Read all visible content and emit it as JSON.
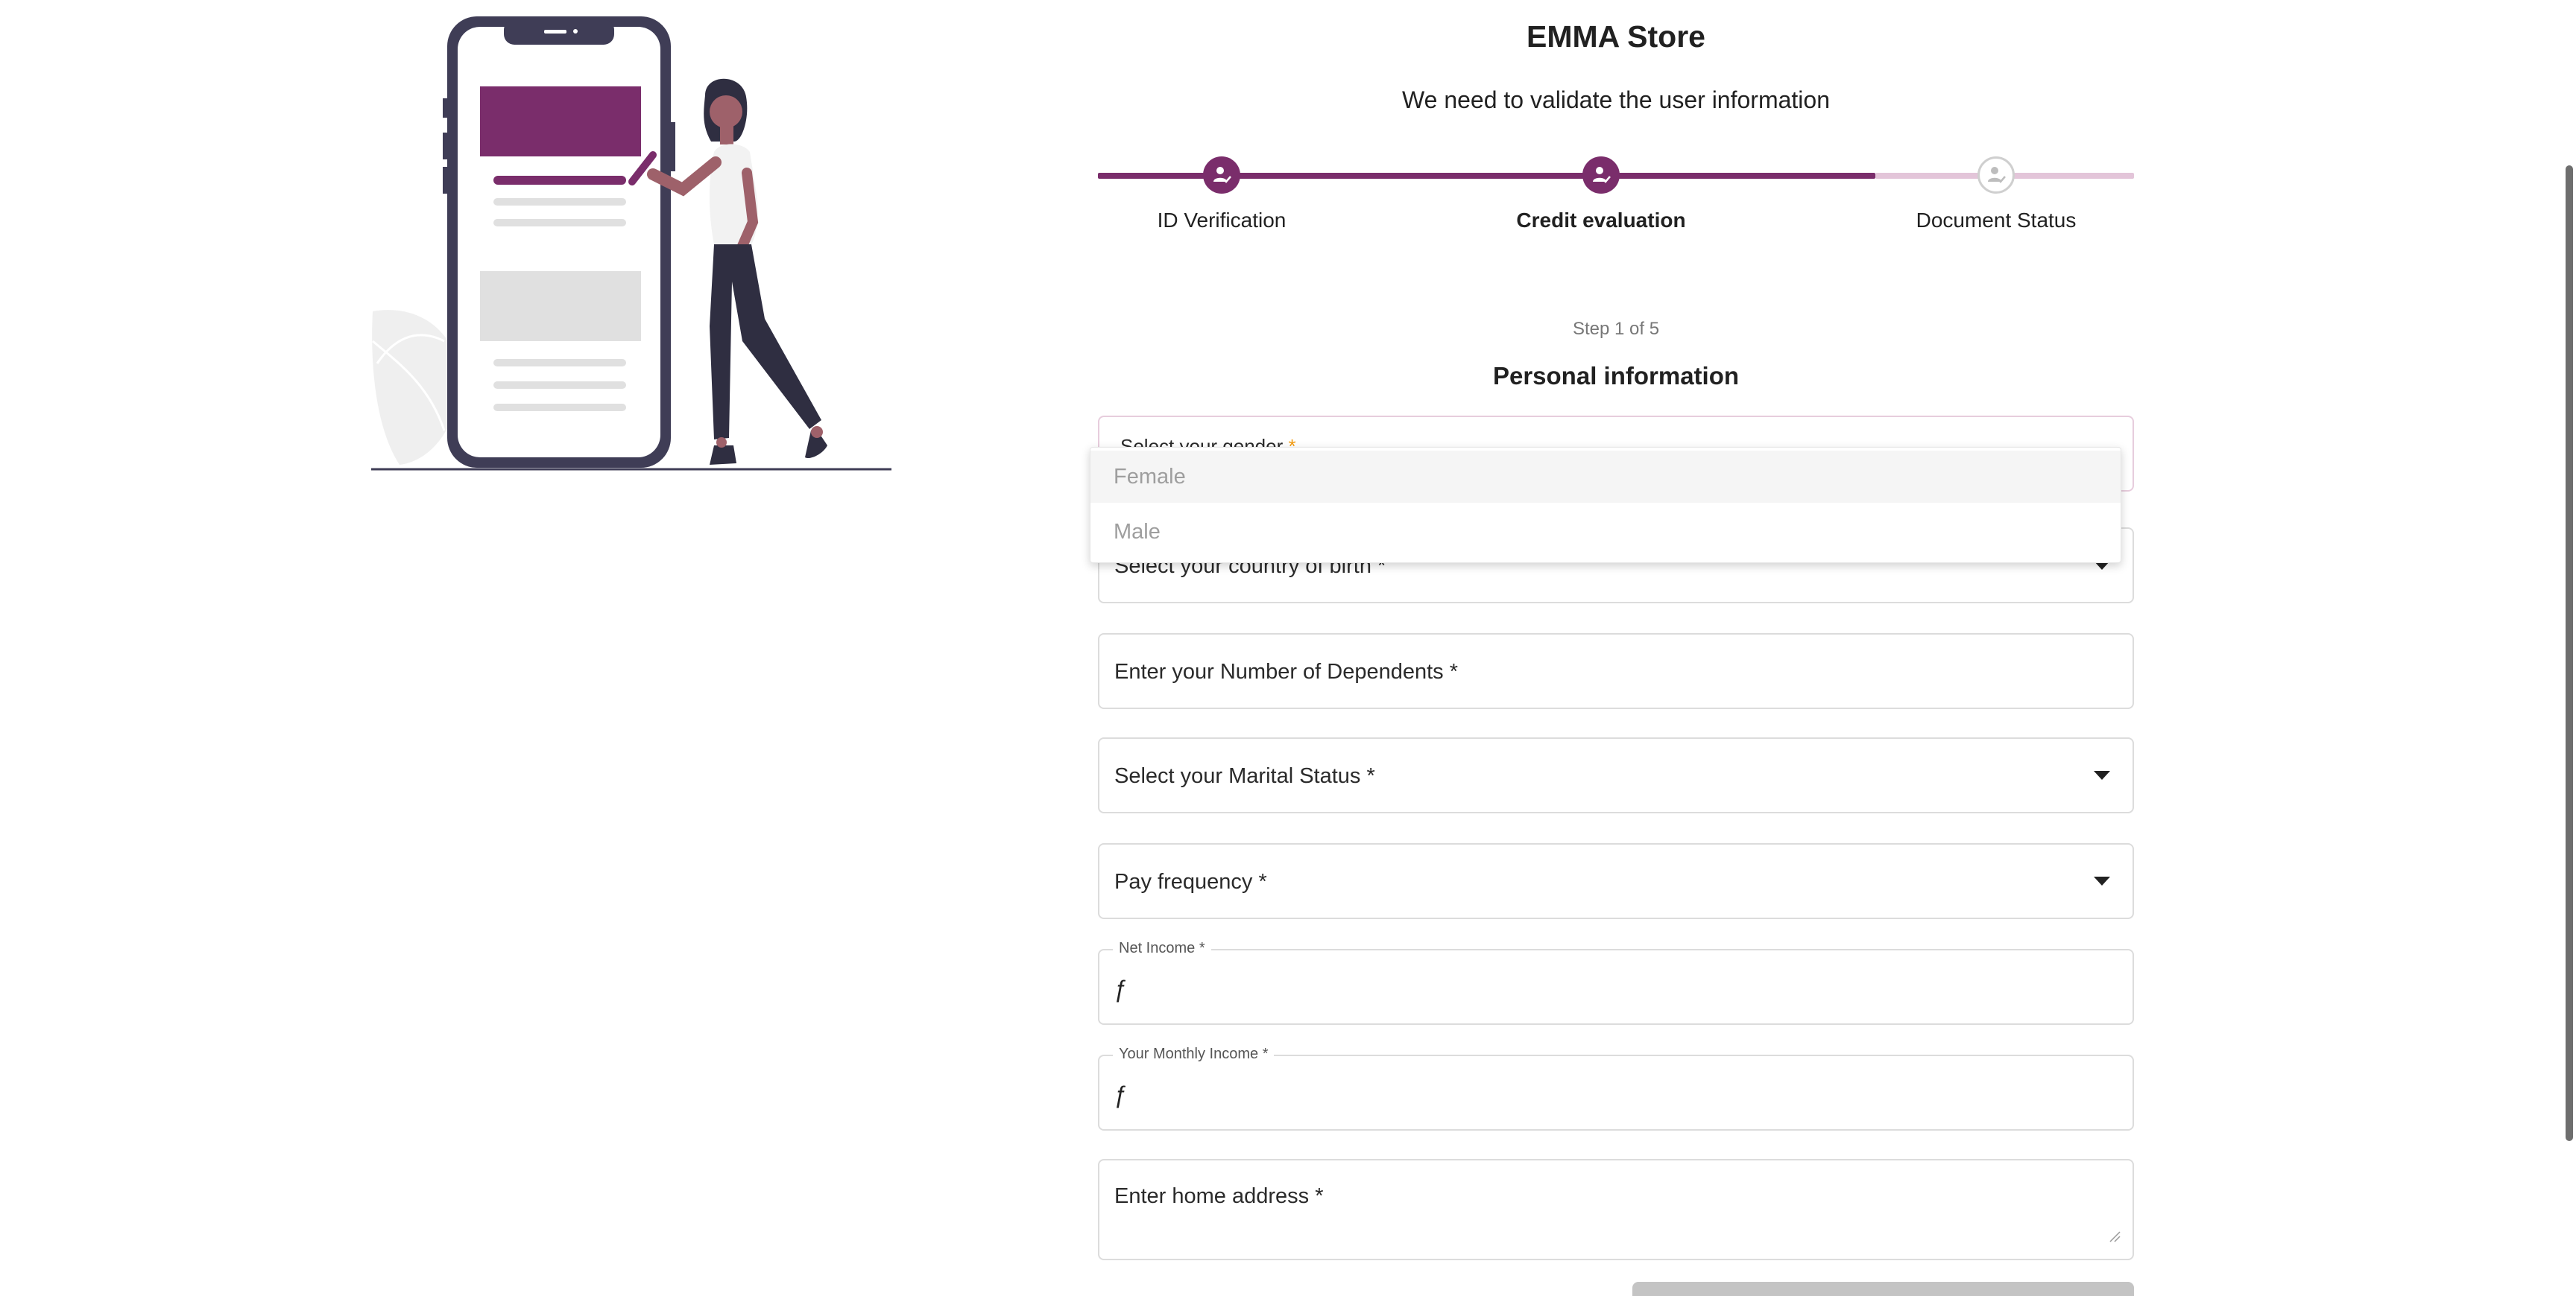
{
  "header": {
    "title": "EMMA Store",
    "subtitle": "We need to validate the user information"
  },
  "stepper": {
    "steps": [
      {
        "label": "ID Verification",
        "state": "complete"
      },
      {
        "label": "Credit evaluation",
        "state": "current"
      },
      {
        "label": "Document Status",
        "state": "pending"
      }
    ],
    "progress_fraction": 0.75
  },
  "form": {
    "step_counter": "Step 1 of 5",
    "section_title": "Personal information",
    "gender": {
      "label": "Select your gender",
      "required_mark": "*"
    },
    "gender_options": [
      "Female",
      "Male"
    ],
    "country_of_birth": {
      "label": "Select your country of birth *"
    },
    "dependents": {
      "label": "Enter your Number of Dependents *"
    },
    "marital_status": {
      "label": "Select your Marital Status *"
    },
    "pay_frequency": {
      "label": "Pay frequency *"
    },
    "net_income": {
      "label": "Net Income *",
      "prefix": "ƒ"
    },
    "monthly_income": {
      "label": "Your Monthly Income *",
      "prefix": "ƒ"
    },
    "home_address": {
      "label": "Enter home address *"
    }
  },
  "colors": {
    "brand": "#7a2d6b",
    "brand_light": "#e3c5d9",
    "required": "#f39c12"
  },
  "icons": {
    "step_complete": "user-check-icon",
    "step_pending": "user-check-icon",
    "dropdown": "caret-down-icon"
  }
}
